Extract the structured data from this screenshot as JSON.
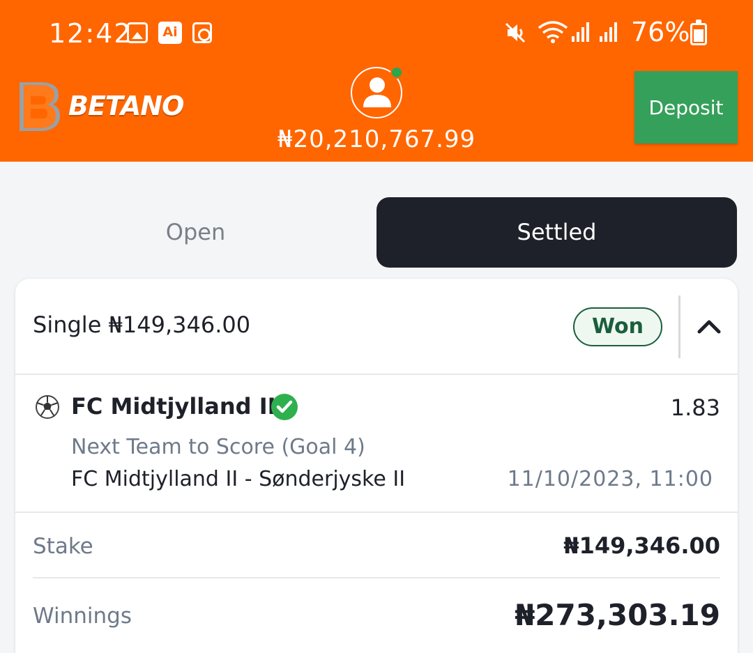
{
  "status_bar": {
    "time": "12:42",
    "battery": "76%",
    "icons": [
      "gallery-icon",
      "ai-icon",
      "clock-icon",
      "mute-icon",
      "wifi-icon",
      "signal-icon",
      "signal-icon",
      "battery-icon"
    ]
  },
  "header": {
    "brand": "BETANO",
    "balance": "₦20,210,767.99",
    "deposit_label": "Deposit",
    "colors": {
      "brand_orange": "#ff6600",
      "deposit_green": "#34a05a",
      "online_dot": "#2da44e"
    }
  },
  "tabs": {
    "open_label": "Open",
    "settled_label": "Settled",
    "active": "Settled"
  },
  "bet": {
    "type": "Single",
    "header_amount": "₦149,346.00",
    "status": "Won",
    "selection": {
      "team": "FC Midtjylland II",
      "odds": "1.83",
      "market": "Next Team to Score (Goal 4)",
      "match": "FC Midtjylland II - Sønderjyske II",
      "datetime": "11/10/2023, 11:00"
    },
    "stake_label": "Stake",
    "stake_value": "₦149,346.00",
    "winnings_label": "Winnings",
    "winnings_value": "₦273,303.19"
  }
}
